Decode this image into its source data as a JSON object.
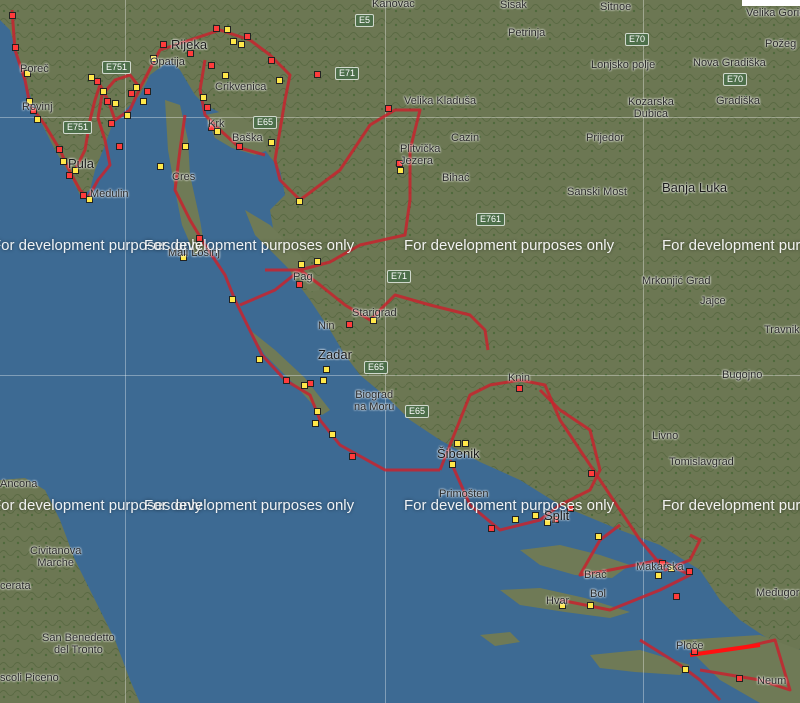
{
  "map": {
    "watermark_text": "For development purposes only",
    "colors": {
      "sea": "#3d6a93",
      "land": "#6f7a56",
      "route": "#c7232e"
    },
    "places": {
      "kanovac": "Kanovac",
      "sisak": "Sisak",
      "sitnoe": "Sitnoe",
      "petrinja": "Petrinja",
      "velika_gorica": "Velika Gorica",
      "pozega": "Požeg",
      "lonjsko_polje": "Lonjsko polje",
      "nova_gradiska": "Nova Gradiška",
      "kozarska_dubica": "Kozarska\nDubica",
      "gradiska": "Gradiška",
      "porec": "Poreč",
      "rijeka": "Rijeka",
      "opatija": "Opatija",
      "crikvenica": "Crikvenica",
      "rovinj": "Rovinj",
      "pula": "Pula",
      "medulin": "Medulin",
      "krk": "Krk",
      "baska": "Baška",
      "cres": "Cres",
      "velika_kladusa": "Velika Kladuša",
      "cazin": "Cazin",
      "prijedor": "Prijedor",
      "plitvicka_jezera": "Plitvička\nJezera",
      "bihac": "Bihać",
      "sanski_most": "Sanski Most",
      "banja_luka": "Banja Luka",
      "mali_losinj": "Mali Lošinj",
      "mrkonjic_grad": "Mrkonjić Grad",
      "jajce": "Jajce",
      "travnik": "Travnik",
      "pag": "Pag",
      "starigrad": "Starigrad",
      "nin": "Nin",
      "zadar": "Zadar",
      "biograd": "Biograd\nna Moru",
      "bugojno": "Bugojno",
      "knin": "Knin",
      "livno": "Livno",
      "tomislavgrad": "Tomislavgrad",
      "sibenik": "Šibenik",
      "primosten": "Primošten",
      "split": "Split",
      "ancona": "Ancona",
      "brac": "Brač",
      "makarska": "Makarska",
      "bol": "Bol",
      "hvar": "Hvar",
      "medugor": "Međugor",
      "civitanova": "Civitanova\nMarche",
      "cerata": "cerata",
      "san_benedetto": "San Benedetto\ndel Tronto",
      "ascoli": "scoli Piceno",
      "ploce": "Ploče",
      "neum": "Neum"
    },
    "roads": {
      "e70_a": "E70",
      "e70_b": "E70",
      "e71_a": "E71",
      "e71_b": "E71",
      "e751_a": "E751",
      "e751_b": "E751",
      "e65_a": "E65",
      "e65_b": "E65",
      "e65_c": "E65",
      "e761": "E761",
      "e5": "E5"
    }
  }
}
